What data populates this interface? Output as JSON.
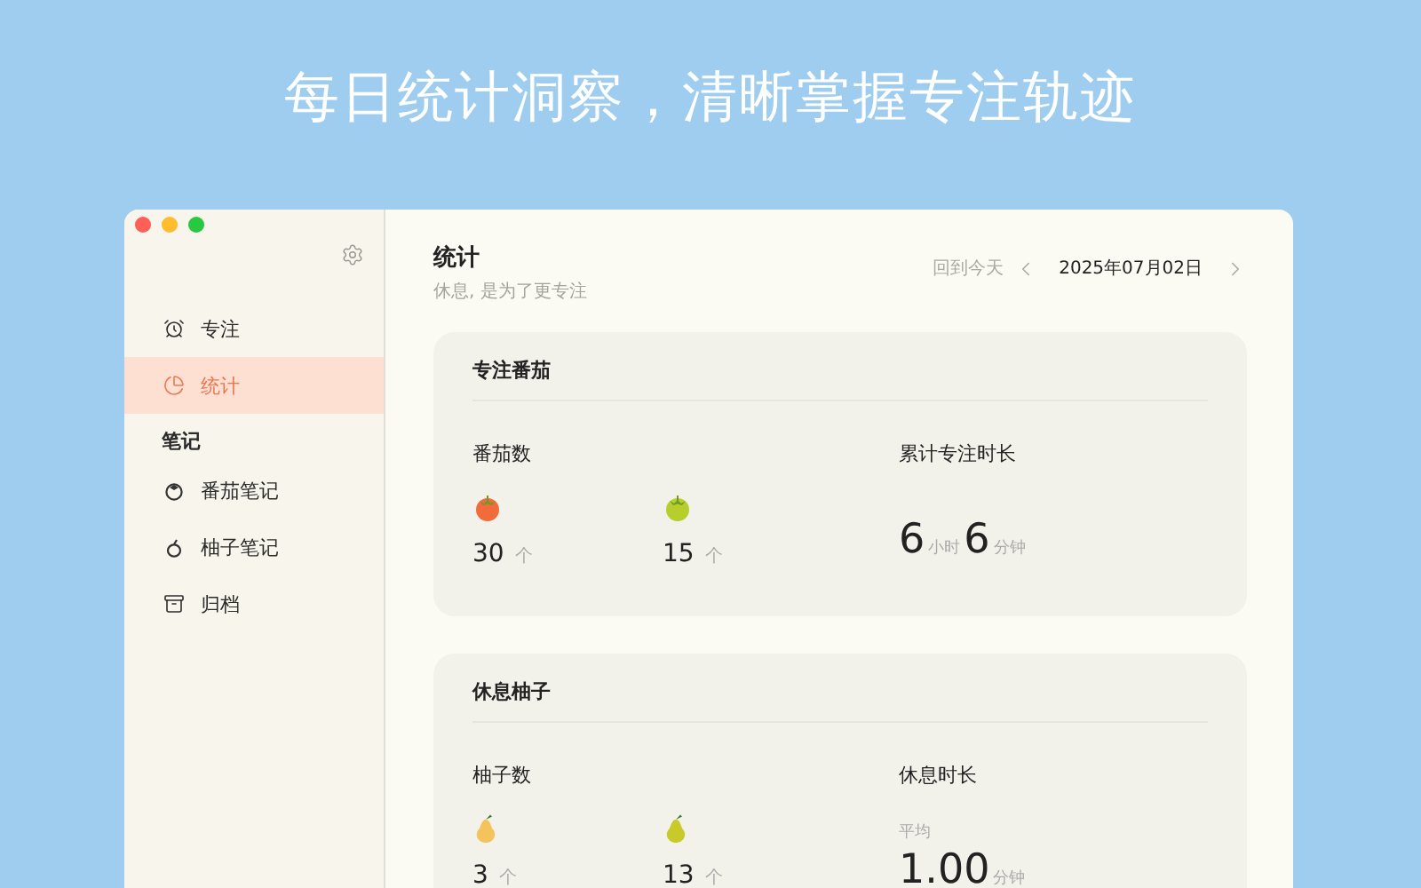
{
  "headline": "每日统计洞察，清晰掌握专注轨迹",
  "window": {
    "traffic_lights": [
      {
        "color": "#fe5f57"
      },
      {
        "color": "#febc2e"
      },
      {
        "color": "#28c840"
      }
    ]
  },
  "sidebar": {
    "items": [
      {
        "kind": "alarm",
        "label": "专注",
        "selected": false
      },
      {
        "kind": "pie",
        "label": "统计",
        "selected": true
      }
    ],
    "section": {
      "title": "笔记",
      "items": [
        {
          "kind": "tomato",
          "label": "番茄笔记",
          "selected": false
        },
        {
          "kind": "pomelo",
          "label": "柚子笔记",
          "selected": false
        },
        {
          "kind": "archive",
          "label": "归档",
          "selected": false
        }
      ]
    }
  },
  "header": {
    "title": "统计",
    "subtitle": "休息, 是为了更专注",
    "today_link": "回到今天",
    "date": "2025年07月02日"
  },
  "cards": [
    {
      "title": "专注番茄",
      "stats": [
        {
          "kind": "counts",
          "label": "番茄数",
          "items": [
            {
              "kind": "tomato",
              "color": "#f26b3a",
              "value": "30",
              "unit": "个"
            },
            {
              "kind": "tomato",
              "color": "#b7cf2d",
              "value": "15",
              "unit": "个"
            }
          ]
        },
        {
          "kind": "duration",
          "label": "累计专注时长",
          "parts": [
            {
              "value": "6",
              "unit": "小时"
            },
            {
              "value": "6",
              "unit": "分钟"
            }
          ]
        }
      ]
    },
    {
      "title": "休息柚子",
      "stats": [
        {
          "kind": "counts",
          "label": "柚子数",
          "items": [
            {
              "kind": "pomelo",
              "color": "#f5c35c",
              "value": "3",
              "unit": "个"
            },
            {
              "kind": "pomelo",
              "color": "#c9c92a",
              "value": "13",
              "unit": "个"
            }
          ]
        },
        {
          "kind": "duration",
          "label": "休息时长",
          "caption": "平均",
          "parts": [
            {
              "value": "1.00",
              "unit": "分钟"
            }
          ]
        }
      ]
    }
  ]
}
